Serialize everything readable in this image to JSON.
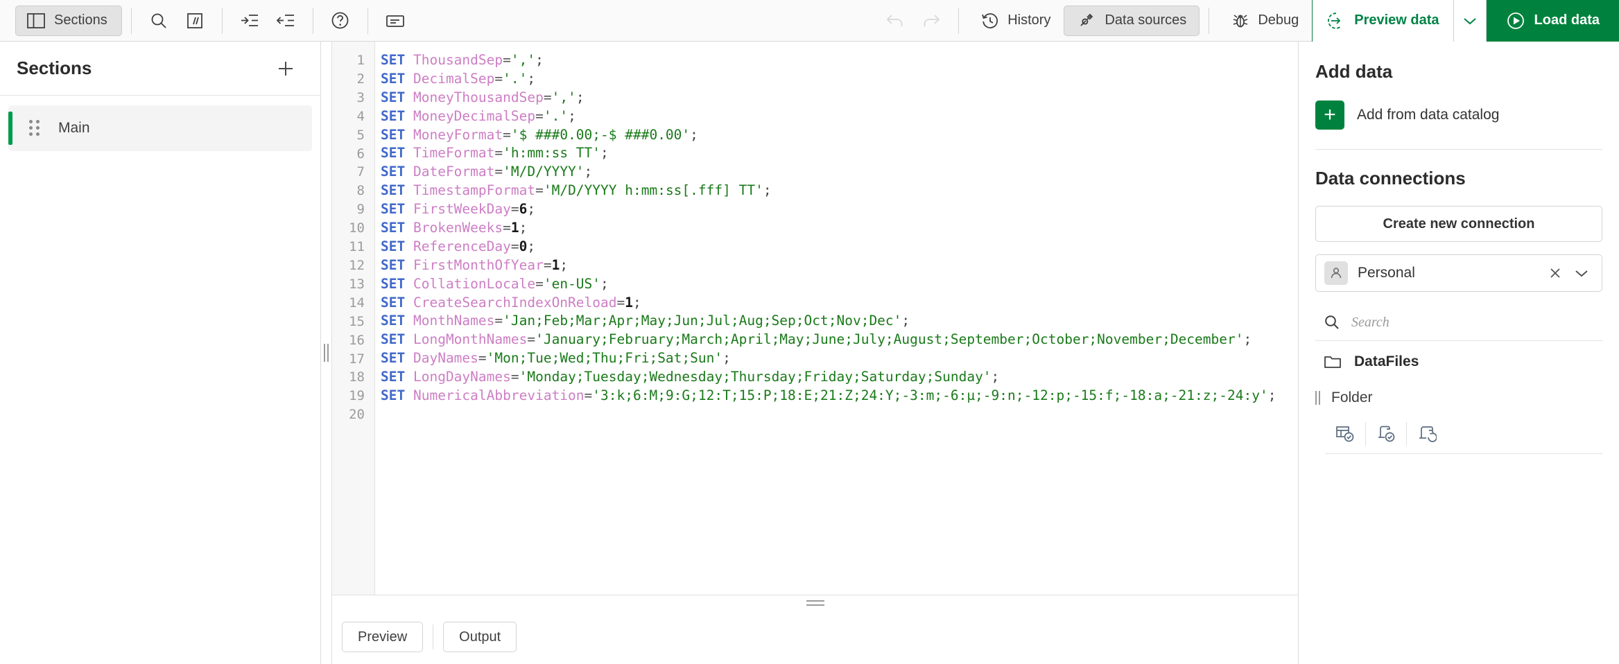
{
  "toolbar": {
    "sections_button": {
      "label": "Sections",
      "icon": "panel-layout-icon"
    },
    "icons": [
      {
        "name": "search-icon",
        "title": "Search"
      },
      {
        "name": "comment-icon",
        "title": "Comment"
      },
      {
        "name": "indent-increase-icon",
        "title": "Indent"
      },
      {
        "name": "indent-decrease-icon",
        "title": "Outdent"
      },
      {
        "name": "help-icon",
        "title": "Help"
      },
      {
        "name": "hints-icon",
        "title": "Hints"
      }
    ],
    "undo_label": "Undo",
    "redo_label": "Redo",
    "history_label": "History",
    "data_sources_label": "Data sources",
    "debug_label": "Debug",
    "preview_data_label": "Preview data",
    "load_data_label": "Load data",
    "accent_green": "#00823e",
    "preview_text_green": "#008346"
  },
  "sections": {
    "title": "Sections",
    "add_label": "+",
    "items": [
      {
        "label": "Main",
        "accent": "#009b4d",
        "selected": true
      }
    ]
  },
  "editor": {
    "line_numbers": [
      "1",
      "2",
      "3",
      "4",
      "5",
      "6",
      "7",
      "8",
      "9",
      "10",
      "11",
      "12",
      "13",
      "14",
      "15",
      "16",
      "17",
      "18",
      "19",
      "20"
    ],
    "lines": [
      {
        "n": 1,
        "kw": "SET",
        "var": "ThousandSep",
        "op": "=",
        "val": "','",
        "val_type": "str",
        "end": ";"
      },
      {
        "n": 2,
        "kw": "SET",
        "var": "DecimalSep",
        "op": "=",
        "val": "'.'",
        "val_type": "str",
        "end": ";"
      },
      {
        "n": 3,
        "kw": "SET",
        "var": "MoneyThousandSep",
        "op": "=",
        "val": "','",
        "val_type": "str",
        "end": ";"
      },
      {
        "n": 4,
        "kw": "SET",
        "var": "MoneyDecimalSep",
        "op": "=",
        "val": "'.'",
        "val_type": "str",
        "end": ";"
      },
      {
        "n": 5,
        "kw": "SET",
        "var": "MoneyFormat",
        "op": "=",
        "val": "'$ ###0.00;-$ ###0.00'",
        "val_type": "str",
        "end": ";"
      },
      {
        "n": 6,
        "kw": "SET",
        "var": "TimeFormat",
        "op": "=",
        "val": "'h:mm:ss TT'",
        "val_type": "str",
        "end": ";"
      },
      {
        "n": 7,
        "kw": "SET",
        "var": "DateFormat",
        "op": "=",
        "val": "'M/D/YYYY'",
        "val_type": "str",
        "end": ";"
      },
      {
        "n": 8,
        "kw": "SET",
        "var": "TimestampFormat",
        "op": "=",
        "val": "'M/D/YYYY h:mm:ss[.fff] TT'",
        "val_type": "str",
        "end": ";"
      },
      {
        "n": 9,
        "kw": "SET",
        "var": "FirstWeekDay",
        "op": "=",
        "val": "6",
        "val_type": "num",
        "end": ";"
      },
      {
        "n": 10,
        "kw": "SET",
        "var": "BrokenWeeks",
        "op": "=",
        "val": "1",
        "val_type": "num",
        "end": ";"
      },
      {
        "n": 11,
        "kw": "SET",
        "var": "ReferenceDay",
        "op": "=",
        "val": "0",
        "val_type": "num",
        "end": ";"
      },
      {
        "n": 12,
        "kw": "SET",
        "var": "FirstMonthOfYear",
        "op": "=",
        "val": "1",
        "val_type": "num",
        "end": ";"
      },
      {
        "n": 13,
        "kw": "SET",
        "var": "CollationLocale",
        "op": "=",
        "val": "'en-US'",
        "val_type": "str",
        "end": ";"
      },
      {
        "n": 14,
        "kw": "SET",
        "var": "CreateSearchIndexOnReload",
        "op": "=",
        "val": "1",
        "val_type": "num",
        "end": ";"
      },
      {
        "n": 15,
        "kw": "SET",
        "var": "MonthNames",
        "op": "=",
        "val": "'Jan;Feb;Mar;Apr;May;Jun;Jul;Aug;Sep;Oct;Nov;Dec'",
        "val_type": "str",
        "end": ";"
      },
      {
        "n": 16,
        "kw": "SET",
        "var": "LongMonthNames",
        "op": "=",
        "val": "'January;February;March;April;May;June;July;August;September;October;November;December'",
        "val_type": "str",
        "end": ";"
      },
      {
        "n": 17,
        "kw": "SET",
        "var": "DayNames",
        "op": "=",
        "val": "'Mon;Tue;Wed;Thu;Fri;Sat;Sun'",
        "val_type": "str",
        "end": ";"
      },
      {
        "n": 18,
        "kw": "SET",
        "var": "LongDayNames",
        "op": "=",
        "val": "'Monday;Tuesday;Wednesday;Thursday;Friday;Saturday;Sunday'",
        "val_type": "str",
        "end": ";"
      },
      {
        "n": 19,
        "kw": "SET",
        "var": "NumericalAbbreviation",
        "op": "=",
        "val": "'3:k;6:M;9:G;12:T;15:P;18:E;21:Z;24:Y;-3:m;-6:µ;-9:n;-12:p;-15:f;-18:a;-21:z;-24:y'",
        "val_type": "str",
        "end": ";"
      },
      {
        "n": 20,
        "kw": "",
        "var": "",
        "op": "",
        "val": "",
        "val_type": "none",
        "end": ""
      }
    ],
    "colors": {
      "keyword": "#4169c9",
      "variable": "#cd7ec4",
      "string": "#1a7a1a",
      "number": "#1a1a1a",
      "gutter_text": "#9b9b9b"
    }
  },
  "bottom": {
    "preview_tab": "Preview",
    "output_tab": "Output"
  },
  "right_panel": {
    "add_data_title": "Add data",
    "add_from_catalog_label": "Add from data catalog",
    "data_connections_title": "Data connections",
    "create_connection_label": "Create new connection",
    "connection_selected": "Personal",
    "search_placeholder": "Search",
    "folders": [
      {
        "label": "DataFiles",
        "icon": "folder-icon"
      }
    ],
    "connection_type_label": "Folder",
    "connection_action_icons": [
      {
        "name": "select-data-icon"
      },
      {
        "name": "insert-script-icon"
      },
      {
        "name": "edit-connection-icon"
      }
    ]
  }
}
